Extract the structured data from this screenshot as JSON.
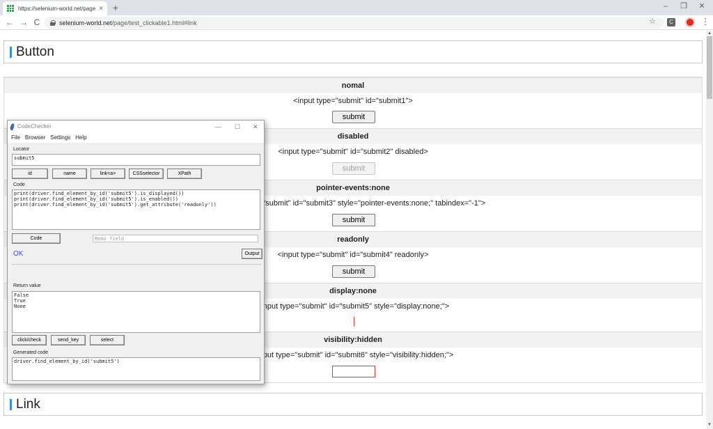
{
  "browser": {
    "tab_title": "https://selenium-world.net/page",
    "tab_close": "×",
    "new_tab": "+",
    "url_host": "selenium-world.net",
    "url_path": "/page/test_clickable1.html#link",
    "back": "←",
    "forward": "→",
    "reload": "C",
    "star": "☆",
    "ext": "C",
    "menu": "⋮",
    "win_min": "–",
    "win_max": "❐",
    "win_close": "✕"
  },
  "page": {
    "heading_button": "Button",
    "heading_link": "Link",
    "sections": [
      {
        "title": "nomal",
        "code": "<input type=\"submit\" id=\"submit1\">",
        "button": "submit"
      },
      {
        "title": "disabled",
        "code": "<input type=\"submit\" id=\"submit2\" disabled>",
        "button": "submit"
      },
      {
        "title": "pointer-events:none",
        "code": "<input type=\"submit\" id=\"submit3\" style=\"pointer-events:none;\" tabindex=\"-1\">",
        "button": "submit"
      },
      {
        "title": "readonly",
        "code": "<input type=\"submit\" id=\"submit4\" readonly>",
        "button": "submit"
      },
      {
        "title": "display:none",
        "code": "<input type=\"submit\" id=\"submit5\" style=\"display:none;\">"
      },
      {
        "title": "visibility:hidden",
        "code": "<input type=\"submit\" id=\"submit6\" style=\"visibility:hidden;\">"
      }
    ]
  },
  "codechecker": {
    "title": "CodeChecker",
    "win_min": "—",
    "win_max": "☐",
    "win_close": "✕",
    "menu": [
      "File",
      "Browser",
      "Settings",
      "Help"
    ],
    "locator_label": "Locator",
    "locator_value": "submit5",
    "locator_buttons": [
      "id",
      "name",
      "link<a>",
      "CSSselector",
      "XPath"
    ],
    "code_label": "Code",
    "code_value": "print(driver.find_element_by_id('submit5').is_displayed())\nprint(driver.find_element_by_id('submit5').is_enabled())\nprint(driver.find_element_by_id('submit5').get_attribute('readonly'))",
    "code_button": "Code",
    "memo_placeholder": "Memo field",
    "status": "OK",
    "output_button": "Output",
    "return_label": "Return value",
    "return_value": "False\nTrue\nNone",
    "action_buttons": [
      "click/check",
      "send_key",
      "select"
    ],
    "generated_label": "Generated code",
    "generated_value": "driver.find_element_by_id('submit5')"
  }
}
